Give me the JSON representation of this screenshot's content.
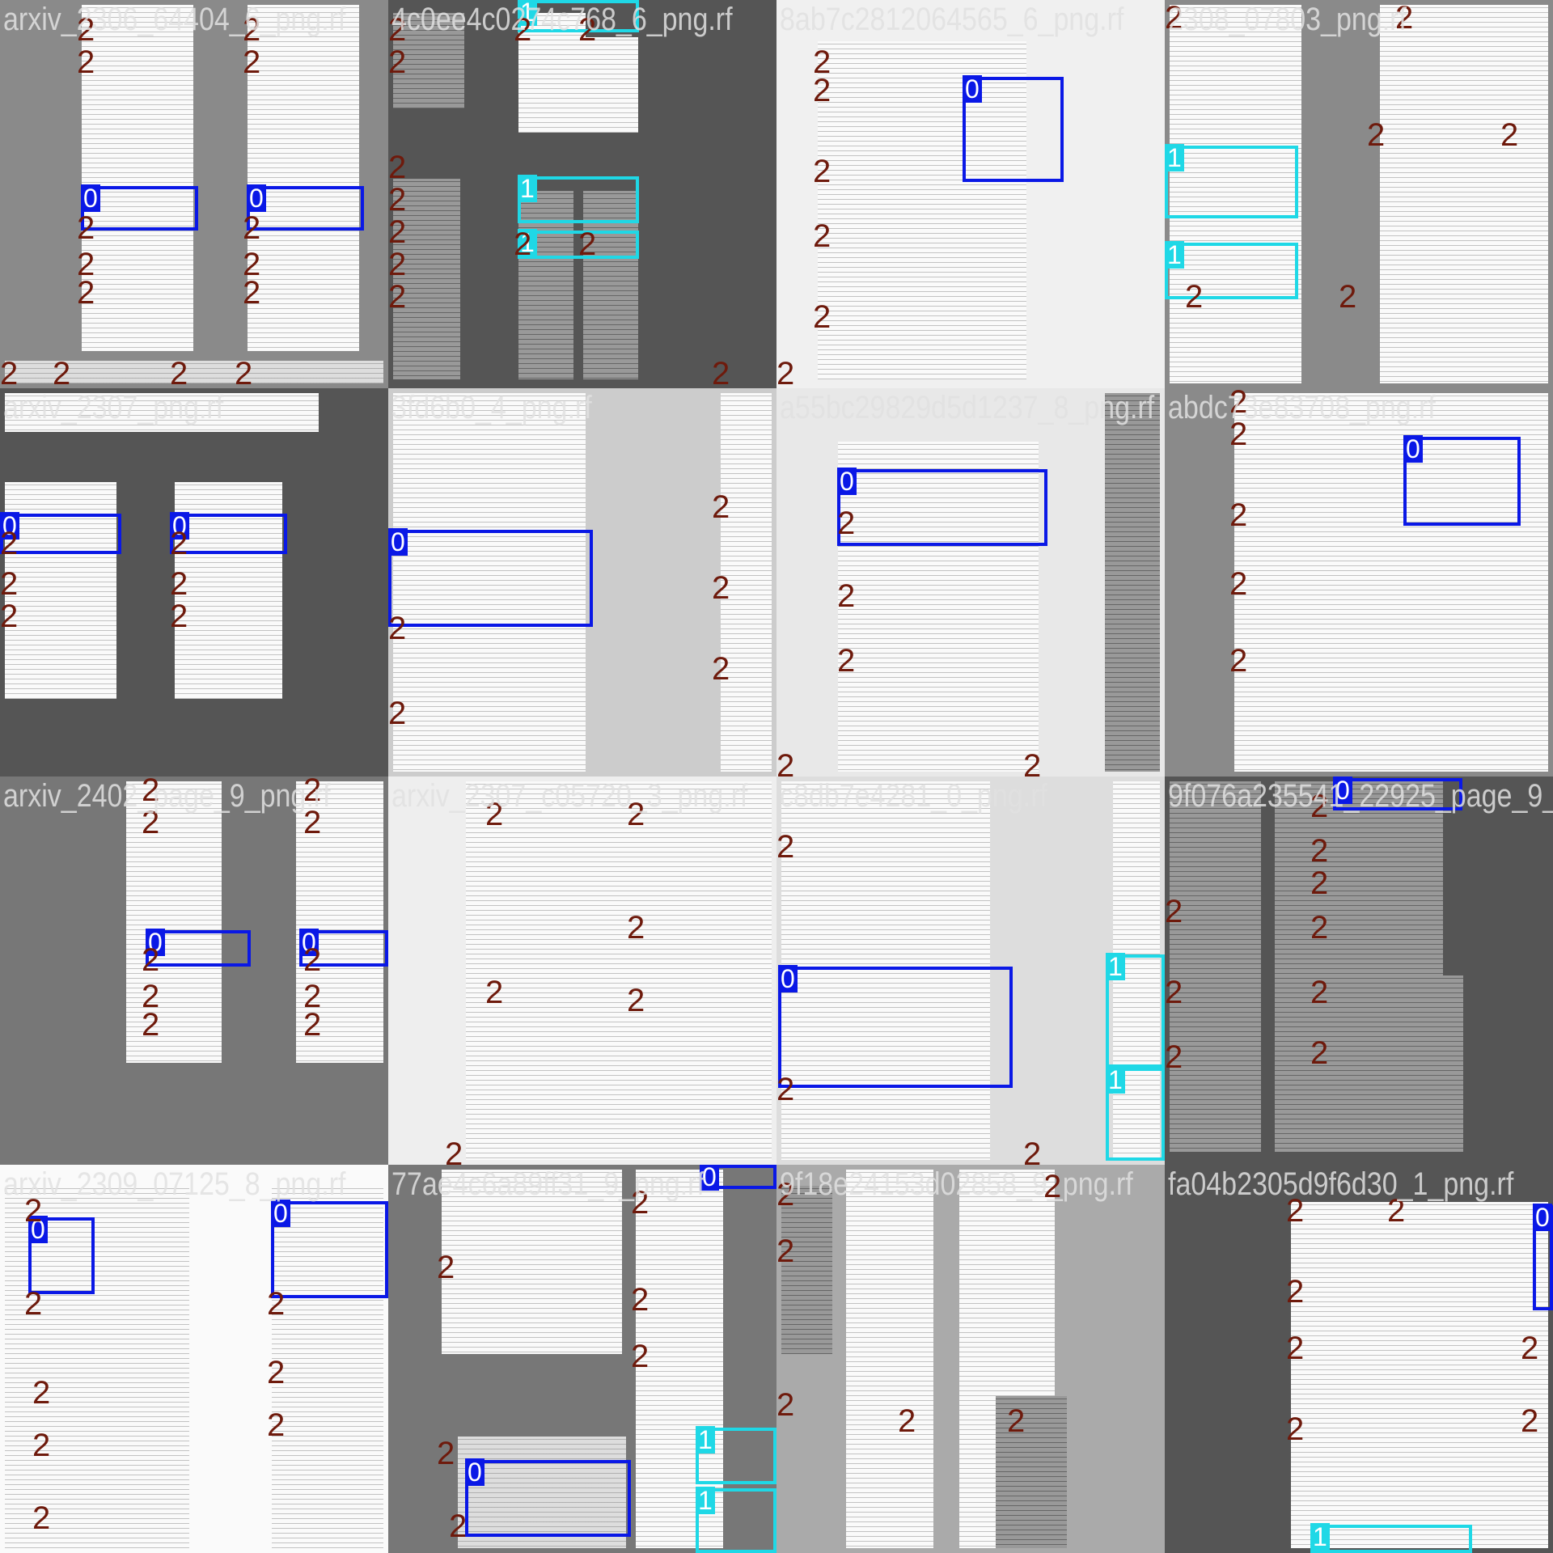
{
  "labels": {
    "c0": "0",
    "c1": "1",
    "c2": "2"
  },
  "tiles": [
    {
      "title": "arxiv_2306_64404_6_png.rf"
    },
    {
      "title": "4c0ee4c0274c768_6_png.rf"
    },
    {
      "title": "8ab7c2812064565_6_png.rf"
    },
    {
      "title": "2308_07803_png.rf"
    },
    {
      "title": "arxiv_2307_png.rf"
    },
    {
      "title": "3fd6b0_4_png.rf"
    },
    {
      "title": "a55bc29829d5d1237_8_png.rf"
    },
    {
      "title": "abdc73e83708_png.rf"
    },
    {
      "title": "arxiv_2402_page_9_png.rf"
    },
    {
      "title": "arxiv_2307_c05720_3_png.rf"
    },
    {
      "title": "c8db7e4281_0_png.rf"
    },
    {
      "title": "9f076a235541_22925_page_9_"
    },
    {
      "title": "arxiv_2309_07125_8_png.rf"
    },
    {
      "title": "77ae4c6a89ff31_9_png.rf"
    },
    {
      "title": "9f18e24153d02858_9_png.rf"
    },
    {
      "title": "fa04b2305d9f6d30_1_png.rf"
    }
  ]
}
